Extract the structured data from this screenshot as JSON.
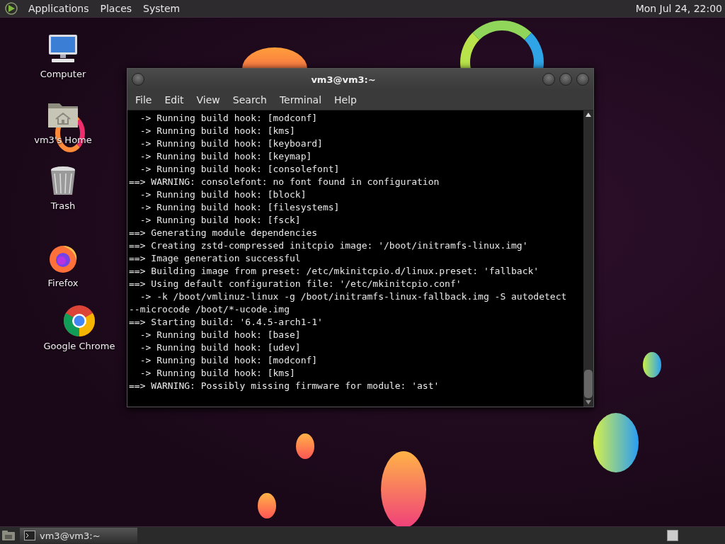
{
  "top_panel": {
    "menus": [
      "Applications",
      "Places",
      "System"
    ],
    "clock": "Mon Jul 24, 22:00"
  },
  "desktop_icons": [
    {
      "kind": "computer",
      "label": "Computer"
    },
    {
      "kind": "home",
      "label": "vm3's Home"
    },
    {
      "kind": "trash",
      "label": "Trash"
    },
    {
      "kind": "firefox",
      "label": "Firefox"
    },
    {
      "kind": "chrome",
      "label": "Google Chrome"
    }
  ],
  "terminal_window": {
    "title": "vm3@vm3:~",
    "menu": [
      "File",
      "Edit",
      "View",
      "Search",
      "Terminal",
      "Help"
    ],
    "lines": [
      "  -> Running build hook: [modconf]",
      "  -> Running build hook: [kms]",
      "  -> Running build hook: [keyboard]",
      "  -> Running build hook: [keymap]",
      "  -> Running build hook: [consolefont]",
      "==> WARNING: consolefont: no font found in configuration",
      "  -> Running build hook: [block]",
      "  -> Running build hook: [filesystems]",
      "  -> Running build hook: [fsck]",
      "==> Generating module dependencies",
      "==> Creating zstd-compressed initcpio image: '/boot/initramfs-linux.img'",
      "==> Image generation successful",
      "==> Building image from preset: /etc/mkinitcpio.d/linux.preset: 'fallback'",
      "==> Using default configuration file: '/etc/mkinitcpio.conf'",
      "  -> -k /boot/vmlinuz-linux -g /boot/initramfs-linux-fallback.img -S autodetect",
      "--microcode /boot/*-ucode.img",
      "==> Starting build: '6.4.5-arch1-1'",
      "  -> Running build hook: [base]",
      "  -> Running build hook: [udev]",
      "  -> Running build hook: [modconf]",
      "  -> Running build hook: [kms]",
      "==> WARNING: Possibly missing firmware for module: 'ast'"
    ]
  },
  "bottom_panel": {
    "tasks": [
      {
        "label": "vm3@vm3:~",
        "selected": true
      }
    ]
  }
}
